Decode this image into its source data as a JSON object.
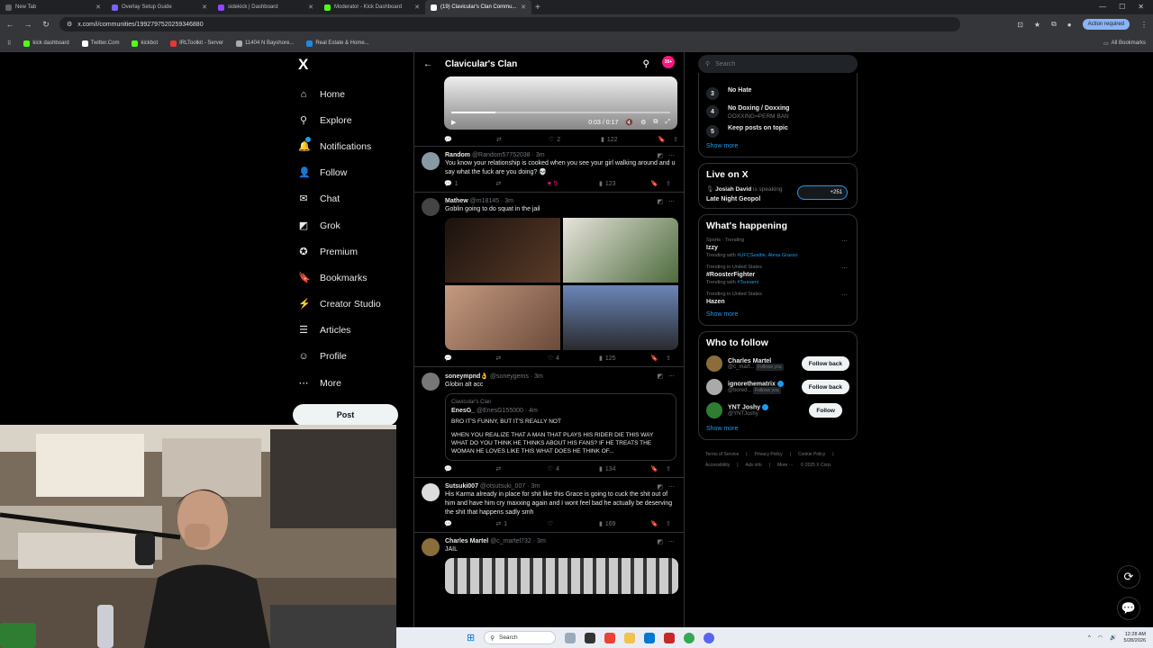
{
  "browser": {
    "tabs": [
      {
        "label": "New Tab",
        "color": "#5f6368"
      },
      {
        "label": "Overlay Setup Guide",
        "color": "#7b61ff"
      },
      {
        "label": "sidekick | Dashboard",
        "color": "#9146ff"
      },
      {
        "label": "Moderator - Kick Dashboard",
        "color": "#53fc18"
      },
      {
        "label": "(19) Clavicular's Clan Commu...",
        "color": "#ffffff"
      }
    ],
    "url": "x.com/i/communities/1992797520259346880",
    "action_required": "Action required",
    "bookmarks": [
      "kick dashboard",
      "Twitter.Com",
      "kickbot",
      "IRLToolkit - Server",
      "11404 N Bayshore...",
      "Real Estate & Home..."
    ],
    "all_bookmarks": "All Bookmarks"
  },
  "nav": {
    "logo": "X",
    "items": [
      {
        "label": "Home",
        "icon": "⌂"
      },
      {
        "label": "Explore",
        "icon": "⚲"
      },
      {
        "label": "Notifications",
        "icon": "🔔"
      },
      {
        "label": "Follow",
        "icon": "👤"
      },
      {
        "label": "Chat",
        "icon": "✉"
      },
      {
        "label": "Grok",
        "icon": "◩"
      },
      {
        "label": "Premium",
        "icon": "✪"
      },
      {
        "label": "Bookmarks",
        "icon": "🔖"
      },
      {
        "label": "Creator Studio",
        "icon": "⚡"
      },
      {
        "label": "Articles",
        "icon": "☰"
      },
      {
        "label": "Profile",
        "icon": "☺"
      },
      {
        "label": "More",
        "icon": "⋯"
      }
    ],
    "post": "Post"
  },
  "feed": {
    "title": "Clavicular's Clan",
    "badge": "20+",
    "video": {
      "time": "0:03 / 0:17"
    },
    "video_actions": {
      "reply": "",
      "repost": "",
      "like": "2",
      "views": "122"
    },
    "tweets": [
      {
        "name": "Random",
        "handle": "@Random57752038 · 3m",
        "text": "You know your relationship is cooked when you see your girl walking around and u say what the fuck are you doing? 💀",
        "actions": {
          "reply": "1",
          "repost": "",
          "like": "5",
          "views": "123"
        },
        "avatar": "#8899a6"
      },
      {
        "name": "Mathew",
        "handle": "@m18145 · 3m",
        "text": "Goblin going to do squat in the jail",
        "actions": {
          "reply": "",
          "repost": "",
          "like": "4",
          "views": "125"
        },
        "avatar": "#444",
        "images": [
          "#3b2a20",
          "#c9c2b7",
          "#b8876b",
          "#4a5a78"
        ]
      },
      {
        "name": "soneympnd👌",
        "handle": "@soneygems · 3m",
        "text": "Globin alt acc",
        "quote": {
          "community": "Clavicular's Clan",
          "user": "EnesG_",
          "handle": "@EnesG155000 · 4m",
          "line1": "BRO IT'S FUNNY, BUT IT'S REALLY NOT",
          "line2": "WHEN YOU REALIZE THAT A MAN THAT PLAYS HIS RIDER DIE THIS WAY WHAT DO YOU THINK HE THINKS ABOUT HIS FANS? IF HE TREATS THE WOMAN HE LOVES LIKE THIS WHAT DOES HE THINK OF..."
        },
        "actions": {
          "reply": "",
          "repost": "",
          "like": "4",
          "views": "134"
        },
        "avatar": "#777"
      },
      {
        "name": "Sutsuki007",
        "handle": "@otsutsuki_007 · 3m",
        "text": "His Karma already in place for shit like this Grace is going to cuck the shit out of him and have him cry maxxing again and I wont feel bad he actually be deserving the shit that happens sadly smh",
        "actions": {
          "reply": "",
          "repost": "1",
          "like": "",
          "views": "169"
        },
        "avatar": "#ddd"
      },
      {
        "name": "Charles Martel",
        "handle": "@c_martel732 · 3m",
        "text": "JAIL",
        "avatar": "#8a6d3b"
      }
    ]
  },
  "right": {
    "search_placeholder": "Search",
    "rules": [
      {
        "num": "3",
        "title": "No Hate",
        "sub": ""
      },
      {
        "num": "4",
        "title": "No Doxing / Doxxing",
        "sub": "DOXXING=PERM BAN"
      },
      {
        "num": "5",
        "title": "Keep posts on topic",
        "sub": ""
      }
    ],
    "show_more": "Show more",
    "live": {
      "title": "Live on X",
      "host": "Josiah David",
      "host_suffix": "is speaking",
      "space": "Late Night Geopol",
      "count": "+251"
    },
    "happening": {
      "title": "What's happening",
      "trends": [
        {
          "ctx": "Sports · Trending",
          "name": "Izzy",
          "with_prefix": "Trending with",
          "with": "#UFCSeattle, Alexa Grasso"
        },
        {
          "ctx": "Trending in United States",
          "name": "#RoosterFighter",
          "with_prefix": "Trending with",
          "with": "#Tsunami"
        },
        {
          "ctx": "Trending in United States",
          "name": "Hazen",
          "with_prefix": "",
          "with": ""
        }
      ]
    },
    "who": {
      "title": "Who to follow",
      "users": [
        {
          "name": "Charles Martel",
          "handle": "@c_mart...",
          "follows_you": "Follows you",
          "button": "Follow back",
          "verified": false,
          "avatar": "#8a6d3b"
        },
        {
          "name": "ignorethematrix",
          "handle": "@bored...",
          "follows_you": "Follows you",
          "button": "Follow back",
          "verified": true,
          "avatar": "#aaa"
        },
        {
          "name": "YNT Joshy",
          "handle": "@YNTJoshy",
          "follows_you": "",
          "button": "Follow",
          "verified": true,
          "avatar": "#2e7d32"
        }
      ]
    },
    "footer": [
      "Terms of Service",
      "|",
      "Privacy Policy",
      "|",
      "Cookie Policy",
      "|",
      "Accessibility",
      "|",
      "Ads info",
      "|",
      "More ···",
      "© 2025 X Corp."
    ]
  },
  "taskbar": {
    "search": "Search",
    "time": "12:28 AM",
    "date": "5/28/2026"
  }
}
